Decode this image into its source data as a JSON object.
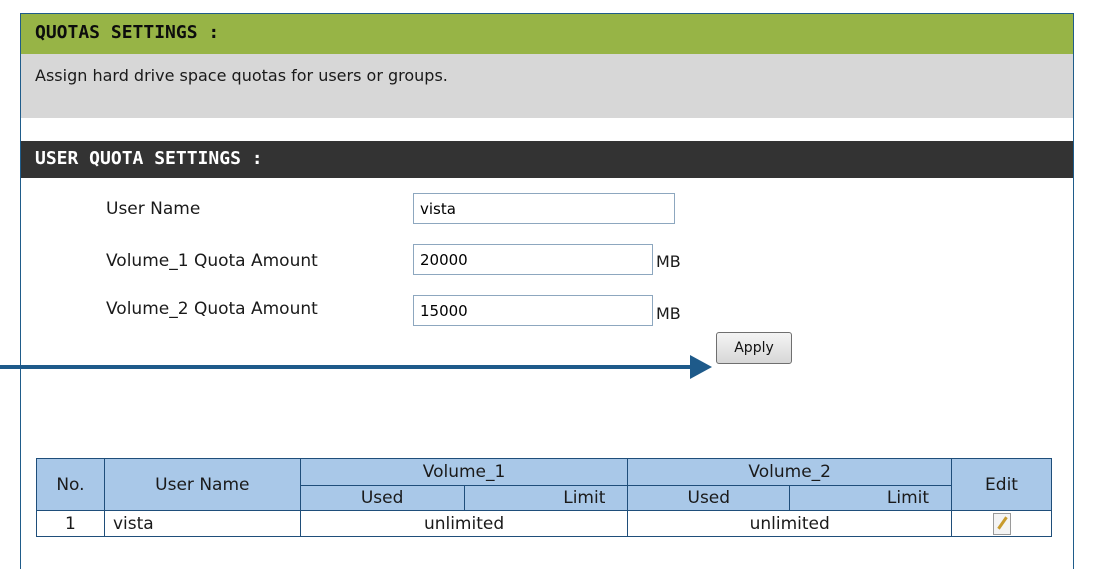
{
  "quotas_settings": {
    "title": "QUOTAS SETTINGS :",
    "description": "Assign hard drive space quotas for users or groups."
  },
  "user_quota_settings": {
    "title": "USER QUOTA SETTINGS :",
    "user_name_label": "User Name",
    "user_name_value": "vista",
    "volume1_label": "Volume_1 Quota Amount",
    "volume1_value": "20000",
    "volume2_label": "Volume_2 Quota Amount",
    "volume2_value": "15000",
    "unit": "MB",
    "apply_label": "Apply"
  },
  "quota_table": {
    "headers": {
      "no": "No.",
      "user_name": "User Name",
      "volume1": "Volume_1",
      "volume2": "Volume_2",
      "used": "Used",
      "limit": "Limit",
      "edit": "Edit"
    },
    "rows": [
      {
        "no": "1",
        "user_name": "vista",
        "volume1": "unlimited",
        "volume2": "unlimited",
        "edit_icon": "edit-icon"
      }
    ]
  },
  "colors": {
    "green_header": "#97b446",
    "gray_bar": "#d7d7d7",
    "dark_header": "#333333",
    "table_header": "#a9c8e8",
    "arrow": "#1e5a8a"
  }
}
